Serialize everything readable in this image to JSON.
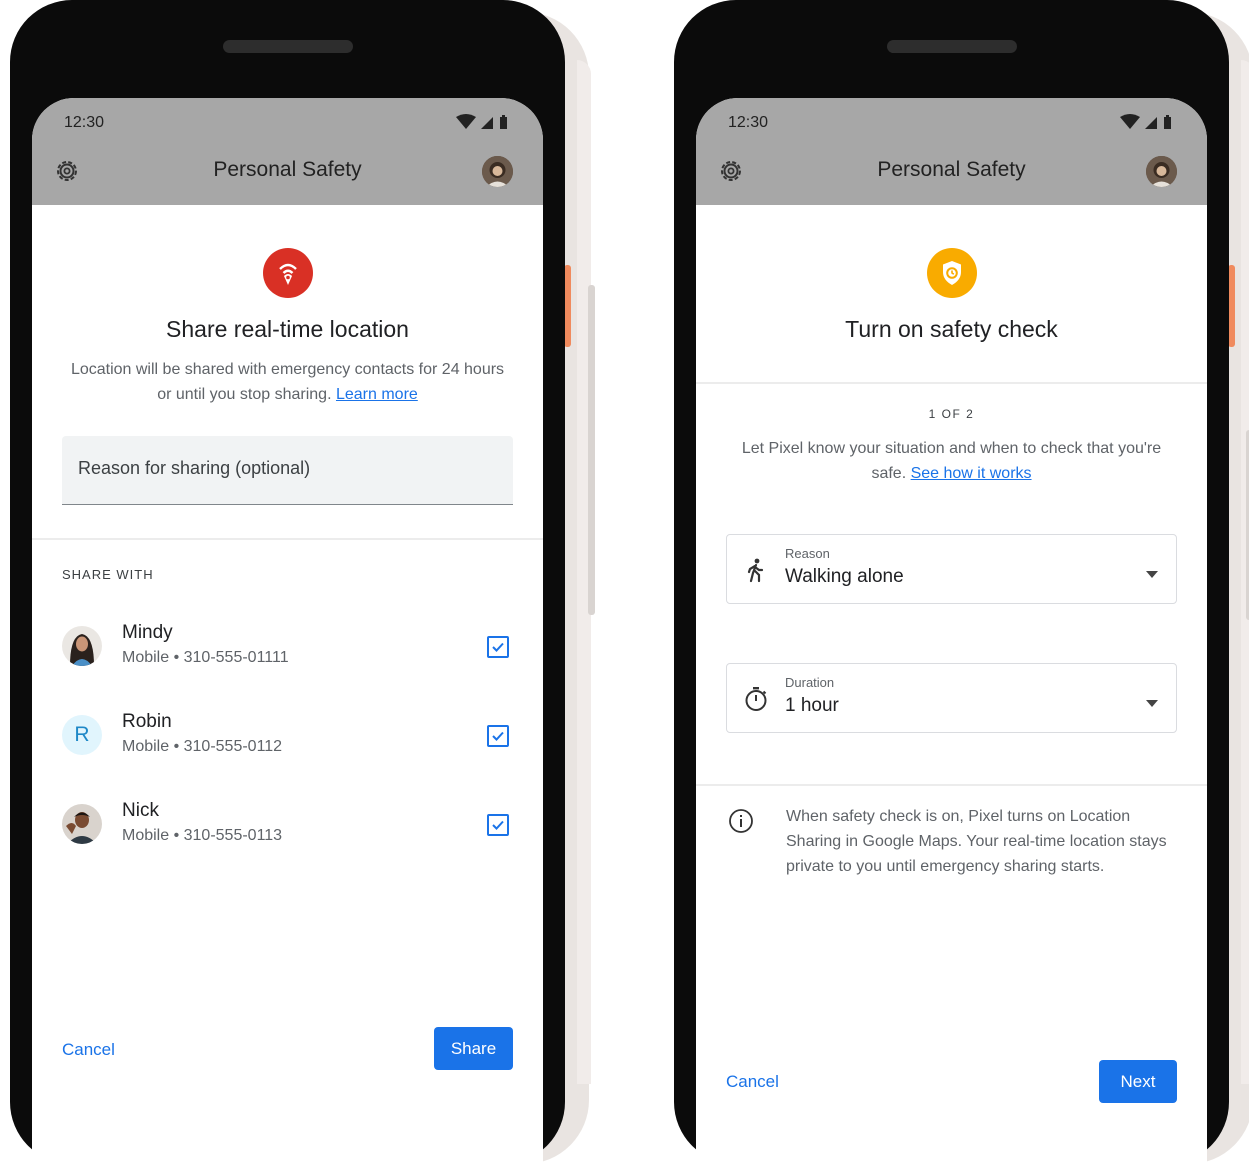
{
  "left_phone": {
    "status": {
      "time": "12:30"
    },
    "app_bar": {
      "title": "Personal Safety"
    },
    "hero": {
      "title": "Share real-time location",
      "description": "Location will be shared with emergency contacts for 24 hours or until you stop sharing.",
      "learn_more": "Learn more"
    },
    "reason_field": {
      "placeholder": "Reason for sharing (optional)"
    },
    "share_with": {
      "heading": "SHARE WITH",
      "contacts": [
        {
          "name": "Mindy",
          "phone": "Mobile • 310-555-01111",
          "checked": true
        },
        {
          "name": "Robin",
          "initial": "R",
          "phone": "Mobile • 310-555-0112",
          "checked": true
        },
        {
          "name": "Nick",
          "phone": "Mobile • 310-555-0113",
          "checked": true
        }
      ]
    },
    "actions": {
      "cancel": "Cancel",
      "share": "Share"
    }
  },
  "right_phone": {
    "status": {
      "time": "12:30"
    },
    "app_bar": {
      "title": "Personal Safety"
    },
    "hero": {
      "title": "Turn on safety check"
    },
    "step": "1 OF 2",
    "intro": {
      "text": "Let Pixel know your situation and when to check that you're safe.",
      "link": "See how it works"
    },
    "reason_select": {
      "label": "Reason",
      "value": "Walking alone"
    },
    "duration_select": {
      "label": "Duration",
      "value": "1 hour"
    },
    "info": "When safety check is on, Pixel turns on Location Sharing in Google Maps. Your real-time location stays private to you until emergency sharing starts.",
    "actions": {
      "cancel": "Cancel",
      "next": "Next"
    }
  },
  "colors": {
    "accent_blue": "#1a73e8",
    "share_location_red": "#d93025",
    "safety_check_amber": "#f9ab00",
    "app_bar_gray": "#a7a7a7",
    "button_rail_orange": "#f08a5d"
  }
}
